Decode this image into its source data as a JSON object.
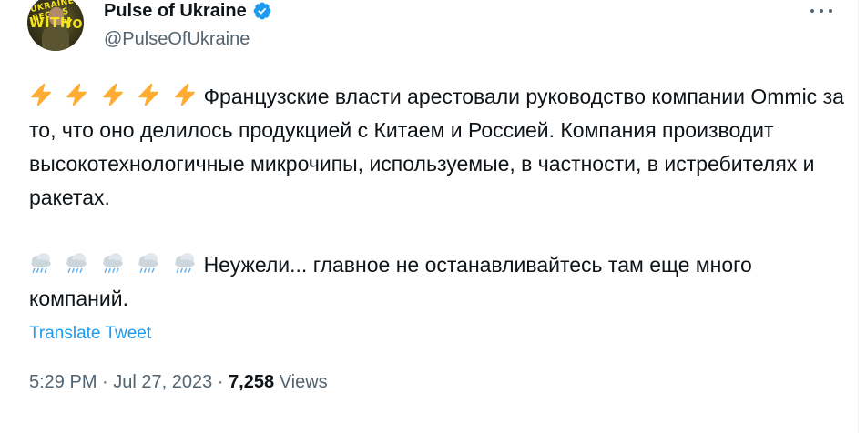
{
  "author": {
    "display_name": "Pulse of Ukraine",
    "handle": "@PulseOfUkraine",
    "verified": true,
    "avatar_text_line1": "UKRAINE BEGINS",
    "avatar_text_line2": "WITH",
    "avatar_text_line3": "YOU"
  },
  "tweet": {
    "paragraph1_emoji_count": 5,
    "paragraph1_emoji": "high-voltage",
    "paragraph1_text": "Французские власти арестовали руководство компании Ommic за то, что оно делилось продукцией с Китаем и Россией. Компания производит высокотехнологичные микрочипы, используемые, в частности, в истребителях и ракетах.",
    "paragraph2_emoji_count": 5,
    "paragraph2_emoji": "cloud-with-rain",
    "paragraph2_text": "Неужели... главное не останавливайтесь там еще много компаний."
  },
  "translate_label": "Translate Tweet",
  "meta": {
    "time": "5:29 PM",
    "separator": "·",
    "date": "Jul 27, 2023",
    "views_count": "7,258",
    "views_label": "Views"
  },
  "colors": {
    "text": "#0f1419",
    "secondary": "#536471",
    "link": "#1d9bf0",
    "verified": "#1d9bf0",
    "bolt": "#ffac33"
  }
}
